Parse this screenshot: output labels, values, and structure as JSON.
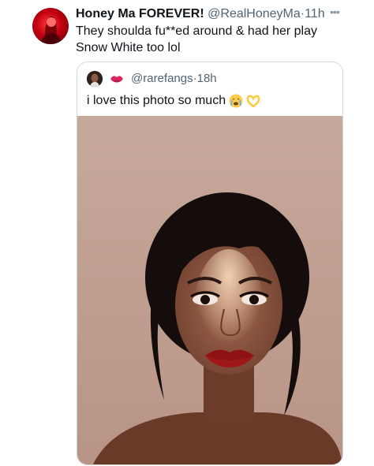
{
  "tweet": {
    "author_name": "Honey Ma FOREVER!",
    "author_handle": "@RealHoneyMa",
    "separator": "·",
    "time": "11h",
    "more_icon": "more-horizontal-icon",
    "text_line1": "They shoulda fu**ed around & had her play",
    "text_line2": "Snow White too lol"
  },
  "quote": {
    "handle": "@rarefangs",
    "separator": "·",
    "time": "18h",
    "text": "i love this photo so much",
    "emoji": [
      "crying-face-icon",
      "heart-hands-icon"
    ],
    "name_icon": "kiss-mark-icon"
  },
  "colors": {
    "text": "#0f1419",
    "secondary": "#536471",
    "border": "#cfd9de",
    "photo_bg": "#c9aa9c"
  }
}
